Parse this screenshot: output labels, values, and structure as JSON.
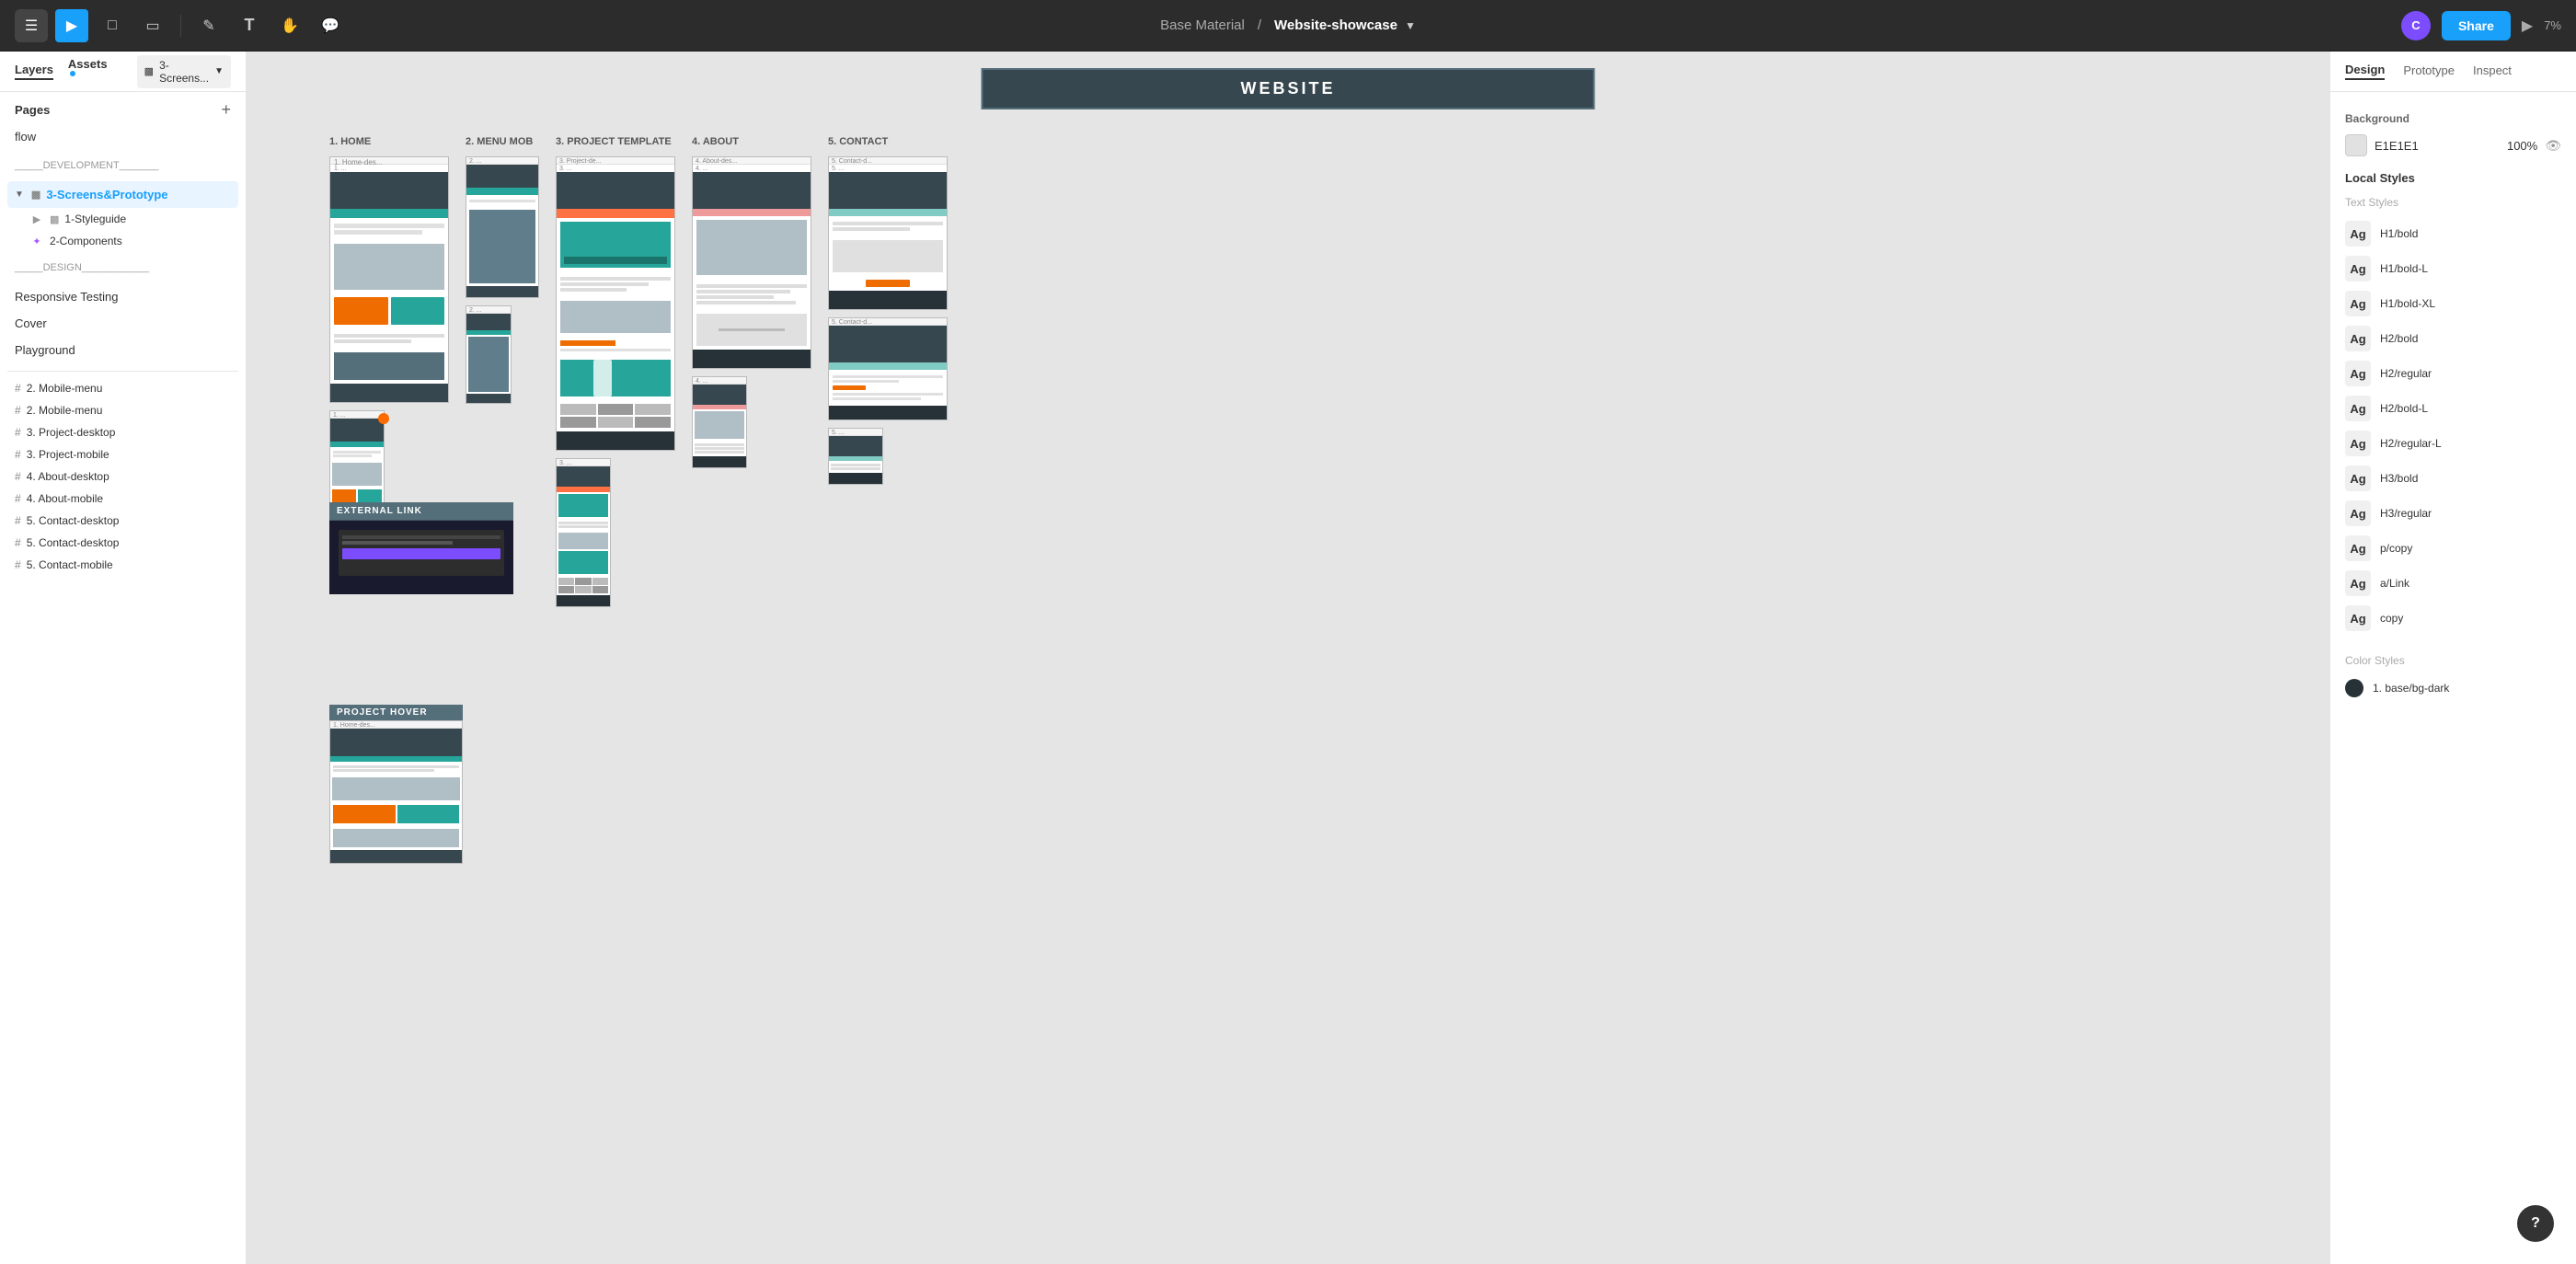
{
  "app": {
    "title": "Base Material",
    "file_name": "Website-showcase",
    "zoom": "7%"
  },
  "toolbar": {
    "menu_label": "☰",
    "tools": [
      {
        "id": "pointer",
        "icon": "▶",
        "active": true
      },
      {
        "id": "frame",
        "icon": "⬜",
        "active": false
      },
      {
        "id": "rect",
        "icon": "▭",
        "active": false
      },
      {
        "id": "vector",
        "icon": "✏",
        "active": false
      },
      {
        "id": "text",
        "icon": "T",
        "active": false
      },
      {
        "id": "hand",
        "icon": "✋",
        "active": false
      },
      {
        "id": "comment",
        "icon": "💬",
        "active": false
      }
    ],
    "share_label": "Share",
    "avatar_initials": "C"
  },
  "left_panel": {
    "tabs": [
      {
        "id": "layers",
        "label": "Layers",
        "active": true
      },
      {
        "id": "assets",
        "label": "Assets",
        "active": false,
        "dot": true
      }
    ],
    "active_page_chip": "3-Screens...",
    "pages": {
      "title": "Pages",
      "items": [
        {
          "id": "flow",
          "label": "flow",
          "type": "page"
        },
        {
          "id": "dev_sep",
          "label": "_____DEVELOPMENT_______",
          "type": "separator"
        },
        {
          "id": "3screens",
          "label": "3-Screens&Prototype",
          "type": "page",
          "active": true,
          "has_chevron": true,
          "icon": "frame"
        },
        {
          "id": "styleguide",
          "label": "1-Styleguide",
          "type": "sub",
          "icon": "frame"
        },
        {
          "id": "components",
          "label": "2-Components",
          "type": "sub",
          "icon": "component"
        },
        {
          "id": "design_sep",
          "label": "_____DESIGN____________",
          "type": "separator"
        },
        {
          "id": "responsive",
          "label": "Responsive Testing",
          "type": "page"
        },
        {
          "id": "cover",
          "label": "Cover",
          "type": "page"
        },
        {
          "id": "playground",
          "label": "Playground",
          "type": "page"
        }
      ]
    },
    "layers": [
      {
        "id": "mobile_menu1",
        "label": "2. Mobile-menu",
        "icon": "#"
      },
      {
        "id": "mobile_menu2",
        "label": "2. Mobile-menu",
        "icon": "#"
      },
      {
        "id": "project_desktop",
        "label": "3. Project-desktop",
        "icon": "#"
      },
      {
        "id": "project_mobile",
        "label": "3. Project-mobile",
        "icon": "#"
      },
      {
        "id": "about_desktop",
        "label": "4. About-desktop",
        "icon": "#"
      },
      {
        "id": "about_mobile",
        "label": "4. About-mobile",
        "icon": "#"
      },
      {
        "id": "contact_desktop1",
        "label": "5. Contact-desktop",
        "icon": "#"
      },
      {
        "id": "contact_desktop2",
        "label": "5. Contact-desktop",
        "icon": "#"
      },
      {
        "id": "contact_mobile",
        "label": "5. Contact-mobile",
        "icon": "#"
      }
    ]
  },
  "canvas": {
    "background_color": "#e5e5e5",
    "label": "WEBSITE",
    "sections": [
      {
        "id": "1_home",
        "label": "1. HOME"
      },
      {
        "id": "2_menu_mob",
        "label": "2. MENU MOB"
      },
      {
        "id": "3_project_template",
        "label": "3. PROJECT TEMPLATE"
      },
      {
        "id": "4_about",
        "label": "4. ABOUT"
      },
      {
        "id": "5_contact",
        "label": "5. CONTACT"
      }
    ],
    "external_link_label": "EXTERNAL LINK",
    "project_hover_label": "PROJECT HOVER"
  },
  "right_panel": {
    "tabs": [
      {
        "id": "design",
        "label": "Design",
        "active": true
      },
      {
        "id": "prototype",
        "label": "Prototype"
      },
      {
        "id": "inspect",
        "label": "Inspect"
      }
    ],
    "background_section": {
      "label": "Background",
      "color_value": "E1E1E1",
      "opacity": "100%"
    },
    "local_styles": {
      "title": "Local Styles",
      "text_styles_label": "Text Styles",
      "items": [
        {
          "id": "h1bold",
          "label": "H1/bold"
        },
        {
          "id": "h1bold_l",
          "label": "H1/bold-L"
        },
        {
          "id": "h1bold_xl",
          "label": "H1/bold-XL"
        },
        {
          "id": "h2bold",
          "label": "H2/bold"
        },
        {
          "id": "h2regular",
          "label": "H2/regular"
        },
        {
          "id": "h2bold_l",
          "label": "H2/bold-L"
        },
        {
          "id": "h2regular_l",
          "label": "H2/regular-L"
        },
        {
          "id": "h3bold",
          "label": "H3/bold"
        },
        {
          "id": "h3regular",
          "label": "H3/regular"
        },
        {
          "id": "pcopy",
          "label": "p/copy"
        },
        {
          "id": "alink",
          "label": "a/Link"
        },
        {
          "id": "copy",
          "label": "copy"
        }
      ],
      "color_styles_label": "Color Styles",
      "color_items": [
        {
          "id": "base_bg_dark",
          "label": "1. base/bg-dark",
          "color": "#263238"
        }
      ]
    }
  },
  "help_button": "?"
}
